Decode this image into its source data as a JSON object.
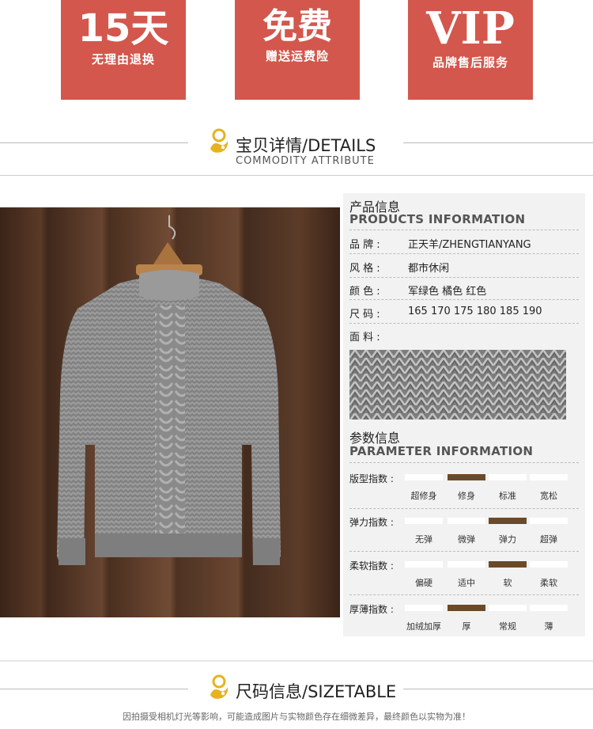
{
  "badges": [
    {
      "big": "15天",
      "small": "无理由退换"
    },
    {
      "big": "免费",
      "small": "赠送运费险"
    },
    {
      "big": "VIP",
      "small": "品牌售后服务"
    }
  ],
  "details_header": {
    "title": "宝贝详情/DETAILS",
    "subtitle": "COMMODITY ATTRIBUTE"
  },
  "product_info": {
    "title_cn": "产品信息",
    "title_en": "PRODUCTS INFORMATION",
    "rows": [
      {
        "key": "品  牌 :",
        "value": "正天羊/ZHENGTIANYANG"
      },
      {
        "key": "风  格 :",
        "value": "都市休闲"
      },
      {
        "key": "颜  色 :",
        "value": "军绿色 橘色 红色"
      },
      {
        "key": "尺  码 :",
        "value": "165 170 175 180 185 190"
      },
      {
        "key": "面  料 :",
        "value": ""
      }
    ]
  },
  "parameter_info": {
    "title_cn": "参数信息",
    "title_en": "PARAMETER INFORMATION",
    "params": [
      {
        "label": "版型指数 :",
        "options": [
          "超修身",
          "修身",
          "标准",
          "宽松"
        ],
        "selected": 1
      },
      {
        "label": "弹力指数 :",
        "options": [
          "无弹",
          "微弹",
          "弹力",
          "超弹"
        ],
        "selected": 2
      },
      {
        "label": "柔软指数 :",
        "options": [
          "偏硬",
          "适中",
          "软",
          "柔软"
        ],
        "selected": 2
      },
      {
        "label": "厚薄指数 :",
        "options": [
          "加绒加厚",
          "厚",
          "常规",
          "薄"
        ],
        "selected": 1
      }
    ]
  },
  "size_header": {
    "title": "尺码信息/SIZETABLE"
  },
  "note": "因拍摄受相机灯光等影响，可能造成图片与实物颜色存在细微差异，最终颜色以实物为准！",
  "colors": {
    "badge": "#d3574c",
    "accent_bar": "#6b4a2a",
    "panel": "#f2f2f2",
    "logo": "#e7b21f"
  }
}
